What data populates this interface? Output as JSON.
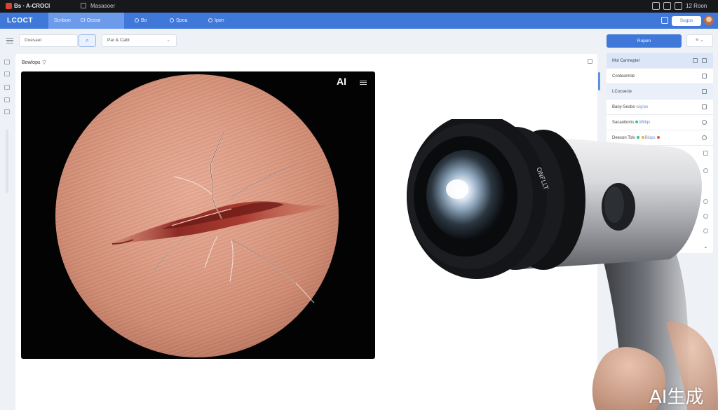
{
  "titlebar": {
    "app_title": "Bs · A-CROCI",
    "document": "Masasoer",
    "user": "12 Roon"
  },
  "navbar": {
    "brand": "LCOCT",
    "tabs": [
      {
        "label": "Scnbon"
      },
      {
        "label": "Ct Ocsse"
      },
      {
        "label": "Bo"
      },
      {
        "label": "Spoa"
      },
      {
        "label": "Ipon"
      }
    ],
    "export_label": "Sugos"
  },
  "toolbar": {
    "search_value": "Doesaet",
    "filter_value": "Par & Cabt",
    "apply_label": "Ropon"
  },
  "panel": {
    "title": "Bowlops"
  },
  "viewer": {
    "badge": "AI"
  },
  "right_panel": {
    "rows": [
      {
        "label": "Mol Carmeptel"
      },
      {
        "label": "Contearmile"
      },
      {
        "label": "LCocsecie"
      },
      {
        "label": "Bany-Sesbo",
        "extra": "wiglan"
      },
      {
        "label": "Sacaoitoms",
        "extra": "Wiliqs"
      },
      {
        "label": "Deeson Tols",
        "extra": "Bisps"
      }
    ]
  },
  "device": {
    "engraving": "ONFLLT"
  },
  "watermark": "AI生成",
  "colors": {
    "accent": "#3f78d8",
    "titlebar": "#16181c",
    "nav_active": "#6d9bec"
  }
}
